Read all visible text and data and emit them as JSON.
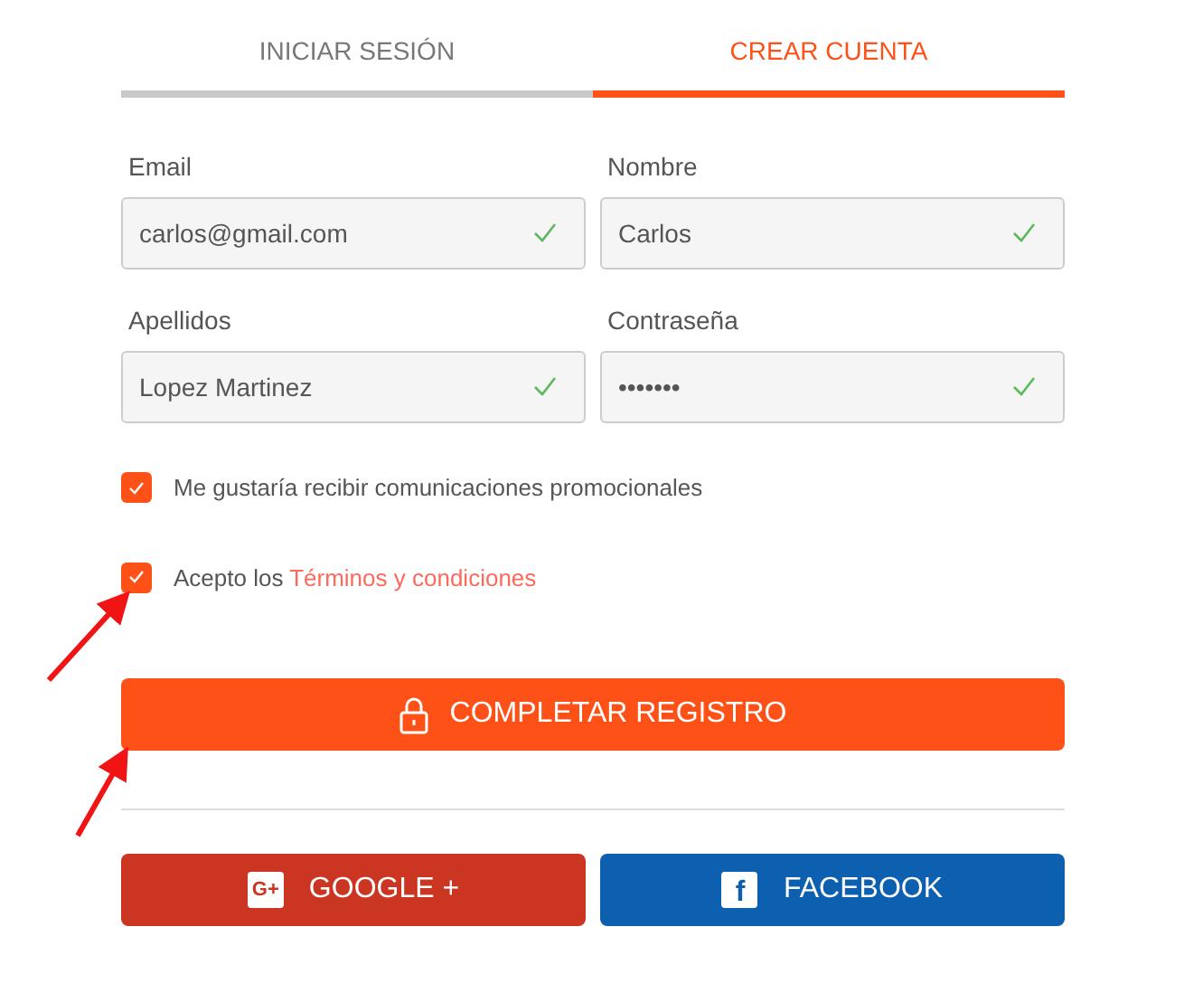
{
  "tabs": [
    {
      "label": "INICIAR SESIÓN",
      "selected": false
    },
    {
      "label": "CREAR CUENTA",
      "selected": true
    }
  ],
  "fields": [
    {
      "label": "Email",
      "value": "carlos@gmail.com",
      "valid": true
    },
    {
      "label": "Nombre",
      "value": "Carlos",
      "valid": true
    },
    {
      "label": "Apellidos",
      "value": "Lopez Martinez",
      "valid": true
    },
    {
      "label": "Contraseña",
      "value": "•••••••",
      "valid": true
    }
  ],
  "checkboxes": [
    {
      "text": "Me gustaría recibir comunicaciones promocionales",
      "checked": true
    },
    {
      "text": "Acepto los ",
      "link": "Términos y condiciones",
      "checked": true
    }
  ],
  "submit_button": {
    "label": "COMPLETAR REGISTRO"
  },
  "social_buttons": [
    {
      "kind": "google",
      "icon_text": "G+",
      "label": "GOOGLE +"
    },
    {
      "kind": "facebook",
      "icon_text": "f",
      "label": "FACEBOOK"
    }
  ]
}
